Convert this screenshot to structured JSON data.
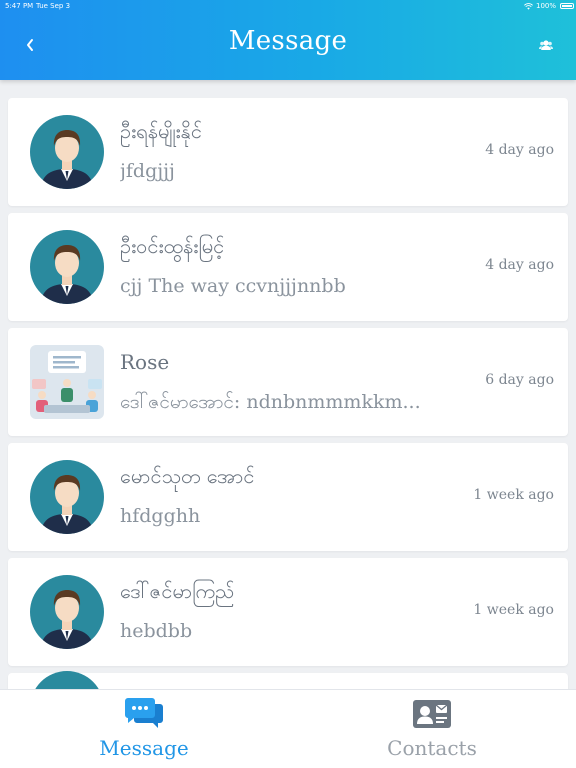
{
  "status_bar": {
    "time": "5:47 PM",
    "date": "Tue Sep 3",
    "battery": "100%"
  },
  "header": {
    "title": "Message",
    "back_icon": "chevron-left-icon",
    "group_icon": "group-icon"
  },
  "conversations": [
    {
      "name": "ဦးရန်မျိုးနိုင်",
      "preview": "jfdgjjj",
      "time": "4 day ago",
      "avatar": "person-avatar"
    },
    {
      "name": "ဦးဝင်းထွန်းမြင့်",
      "preview": "cjj The way ccvnjjjnnbb",
      "time": "4 day ago",
      "avatar": "person-avatar"
    },
    {
      "name": "Rose",
      "preview": "ဒေါ်ဇင်မာအောင်: ndnbnmmmkkm...",
      "time": "6 day ago",
      "avatar": "group-meeting-image"
    },
    {
      "name": "မောင်သုတ အောင်",
      "preview": "hfdgghh",
      "time": "1 week ago",
      "avatar": "person-avatar"
    },
    {
      "name": "ဒေါ်ဇင်မာကြည်",
      "preview": "hebdbb",
      "time": "1 week ago",
      "avatar": "person-avatar"
    }
  ],
  "tabbar": {
    "message_label": "Message",
    "contacts_label": "Contacts",
    "message_icon": "chat-bubbles-icon",
    "contacts_icon": "contact-card-icon",
    "active_color": "#2196e6",
    "inactive_color": "#9aa1a9"
  },
  "colors": {
    "header_gradient_start": "#1e8ff0",
    "header_gradient_end": "#1fc0d9",
    "avatar_bg": "#2a8a9e"
  }
}
